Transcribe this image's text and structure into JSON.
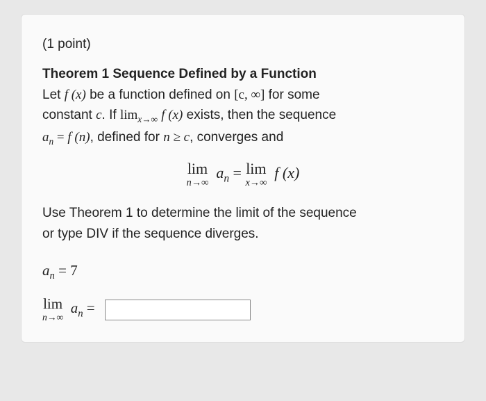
{
  "points_label": "(1 point)",
  "theorem": {
    "title": "Theorem 1 Sequence Defined by a Function",
    "line1_pre": "Let ",
    "fx": "f (x)",
    "line1_mid": " be a function defined on ",
    "interval": "[c, ∞]",
    "line1_post": " for some",
    "line2_pre": "constant ",
    "c": "c",
    "line2_mid": ". If ",
    "lim_inline_prefix": "lim",
    "lim_inline_sub": "x→∞",
    "line2_post": " exists, then the sequence",
    "line3_an": "a",
    "line3_sub": "n",
    "line3_eq": " = ",
    "line3_fn": "f (n)",
    "line3_mid": ", defined for ",
    "line3_cond": "n ≥ c",
    "line3_post": ", converges and"
  },
  "display": {
    "lim": "lim",
    "sub_n": "n→∞",
    "an_a": "a",
    "an_n": "n",
    "eq": " = ",
    "sub_x": "x→∞",
    "fx": "f (x)"
  },
  "instruction": {
    "line1": "Use Theorem 1 to determine the limit of the sequence",
    "line2": "or type DIV if the sequence diverges."
  },
  "sequence": {
    "a": "a",
    "n": "n",
    "eq": " = ",
    "value": "7"
  },
  "answer": {
    "lim": "lim",
    "sub": "n→∞",
    "a": "a",
    "n": "n",
    "eq": " =",
    "input_value": ""
  }
}
